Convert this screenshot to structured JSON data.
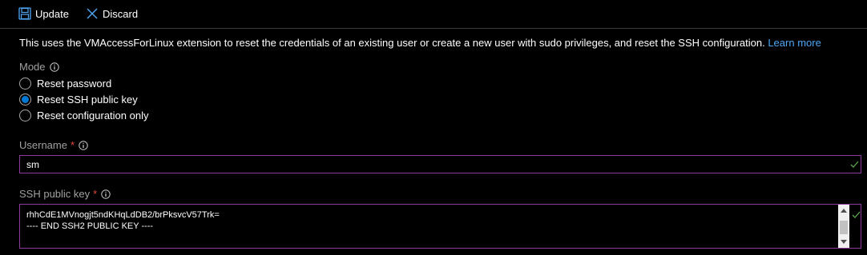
{
  "toolbar": {
    "update_label": "Update",
    "discard_label": "Discard"
  },
  "description": {
    "text": "This uses the VMAccessForLinux extension to reset the credentials of an existing user or create a new user with sudo privileges, and reset the SSH configuration.",
    "link": "Learn more"
  },
  "mode": {
    "label": "Mode",
    "options": [
      {
        "label": "Reset password",
        "selected": false
      },
      {
        "label": "Reset SSH public key",
        "selected": true
      },
      {
        "label": "Reset configuration only",
        "selected": false
      }
    ]
  },
  "username": {
    "label": "Username",
    "required_mark": "*",
    "value": "sm"
  },
  "ssh_key": {
    "label": "SSH public key",
    "required_mark": "*",
    "lines": [
      "rhhCdE1MVnogjt5ndKHqLdDB2/brPksvcV57Trk=",
      "---- END SSH2 PUBLIC KEY ----"
    ]
  },
  "colors": {
    "accent": "#0078d4",
    "link": "#4ea6f5",
    "required": "#e8473a",
    "focus_border": "#8b3c9b",
    "valid_check": "#57a64a"
  }
}
